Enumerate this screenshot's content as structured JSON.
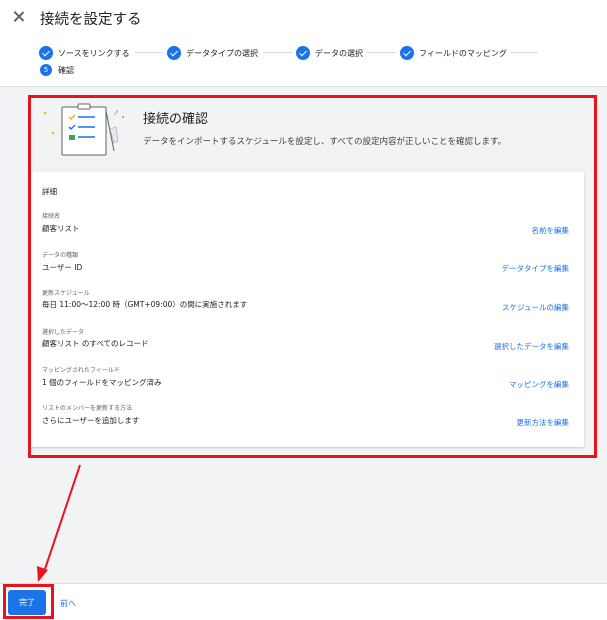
{
  "dialog": {
    "title": "接続を設定する"
  },
  "stepper": {
    "steps": [
      {
        "label": "ソースをリンクする",
        "state": "done"
      },
      {
        "label": "データタイプの選択",
        "state": "done"
      },
      {
        "label": "データの選択",
        "state": "done"
      },
      {
        "label": "フィールドのマッピング",
        "state": "done"
      },
      {
        "label": "確認",
        "state": "current",
        "number": "5"
      }
    ]
  },
  "summary": {
    "title": "接続の確認",
    "description": "データをインポートするスケジュールを設定し、すべての設定内容が正しいことを確認します。"
  },
  "details": {
    "heading": "詳細",
    "fields": [
      {
        "label": "接続名",
        "value": "顧客リスト",
        "edit": "名前を編集"
      },
      {
        "label": "データの種類",
        "value": "ユーザー ID",
        "edit": "データタイプを編集"
      },
      {
        "label": "更新スケジュール",
        "value": "毎日 11:00〜12:00 時（GMT+09:00）の間に実施されます",
        "edit": "スケジュールの編集"
      },
      {
        "label": "選択したデータ",
        "value": "顧客リスト のすべてのレコード",
        "edit": "選択したデータを編集"
      },
      {
        "label": "マッピングされたフィールド",
        "value": "1 個のフィールドをマッピング済み",
        "edit": "マッピングを編集"
      },
      {
        "label": "リストのメンバーを更新する方法",
        "value": "さらにユーザーを追加します",
        "edit": "更新方法を編集"
      }
    ]
  },
  "footer": {
    "done_label": "完了",
    "back_label": "前へ"
  },
  "colors": {
    "accent": "#1a73e8",
    "highlight": "#e8131b"
  }
}
